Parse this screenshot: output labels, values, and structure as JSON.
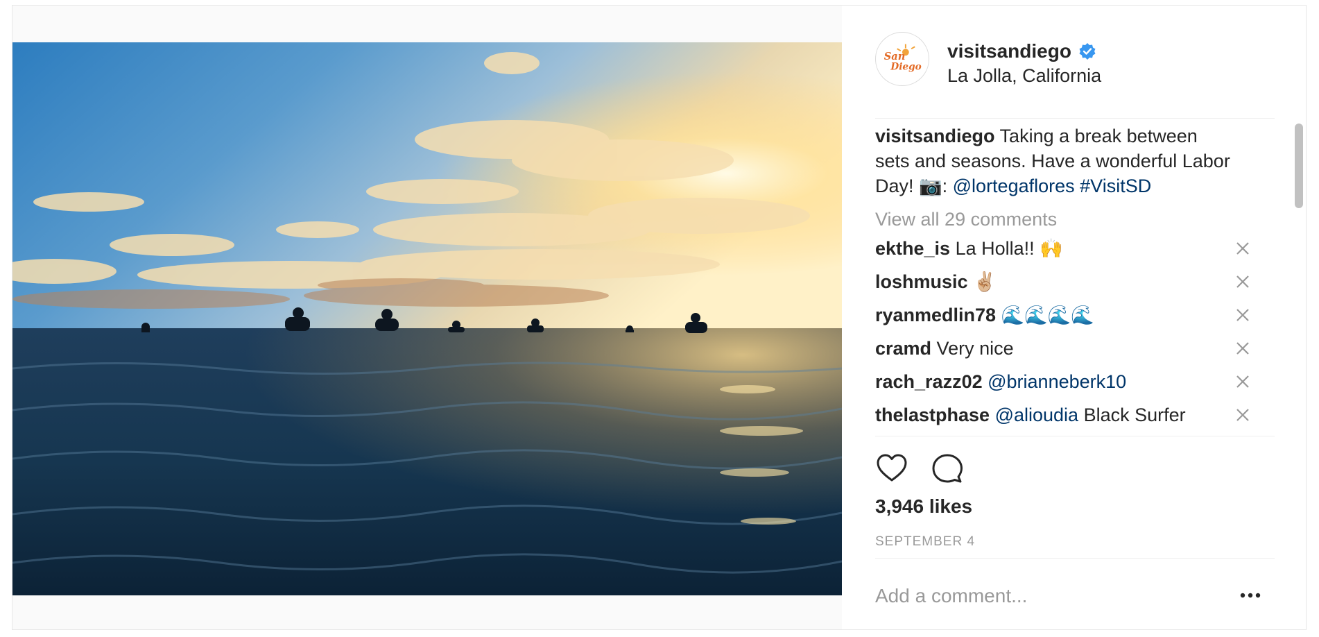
{
  "post": {
    "username": "visitsandiego",
    "location": "La Jolla, California",
    "avatar_text": "San Diego",
    "verified_icon": "verified-badge-icon",
    "accent_color": "#3897f0"
  },
  "caption": {
    "username": "visitsandiego",
    "text_before": " Taking a break between sets and seasons. Have a wonderful Labor Day! 📷: ",
    "mention": "@lortegaflores",
    "hashtag": "#VisitSD"
  },
  "view_all": "View all 29 comments",
  "comments": [
    {
      "user": "ekthe_is",
      "text": " La Holla!! 🙌",
      "link": ""
    },
    {
      "user": "loshmusic",
      "text": " ✌🏼",
      "link": ""
    },
    {
      "user": "ryanmedlin78",
      "text": " 🌊🌊🌊🌊",
      "link": ""
    },
    {
      "user": "cramd",
      "text": " Very nice",
      "link": ""
    },
    {
      "user": "rach_razz02",
      "text": " ",
      "link": "@brianneberk10"
    },
    {
      "user": "thelastphase",
      "text": " Black Surfer",
      "link": "@alioudia"
    }
  ],
  "likes": "3,946 likes",
  "date": "SEPTEMBER 4",
  "add_comment_placeholder": "Add a comment...",
  "icons": {
    "like": "heart-icon",
    "comment": "comment-icon",
    "delete": "close-icon",
    "more": "more-options-icon"
  }
}
